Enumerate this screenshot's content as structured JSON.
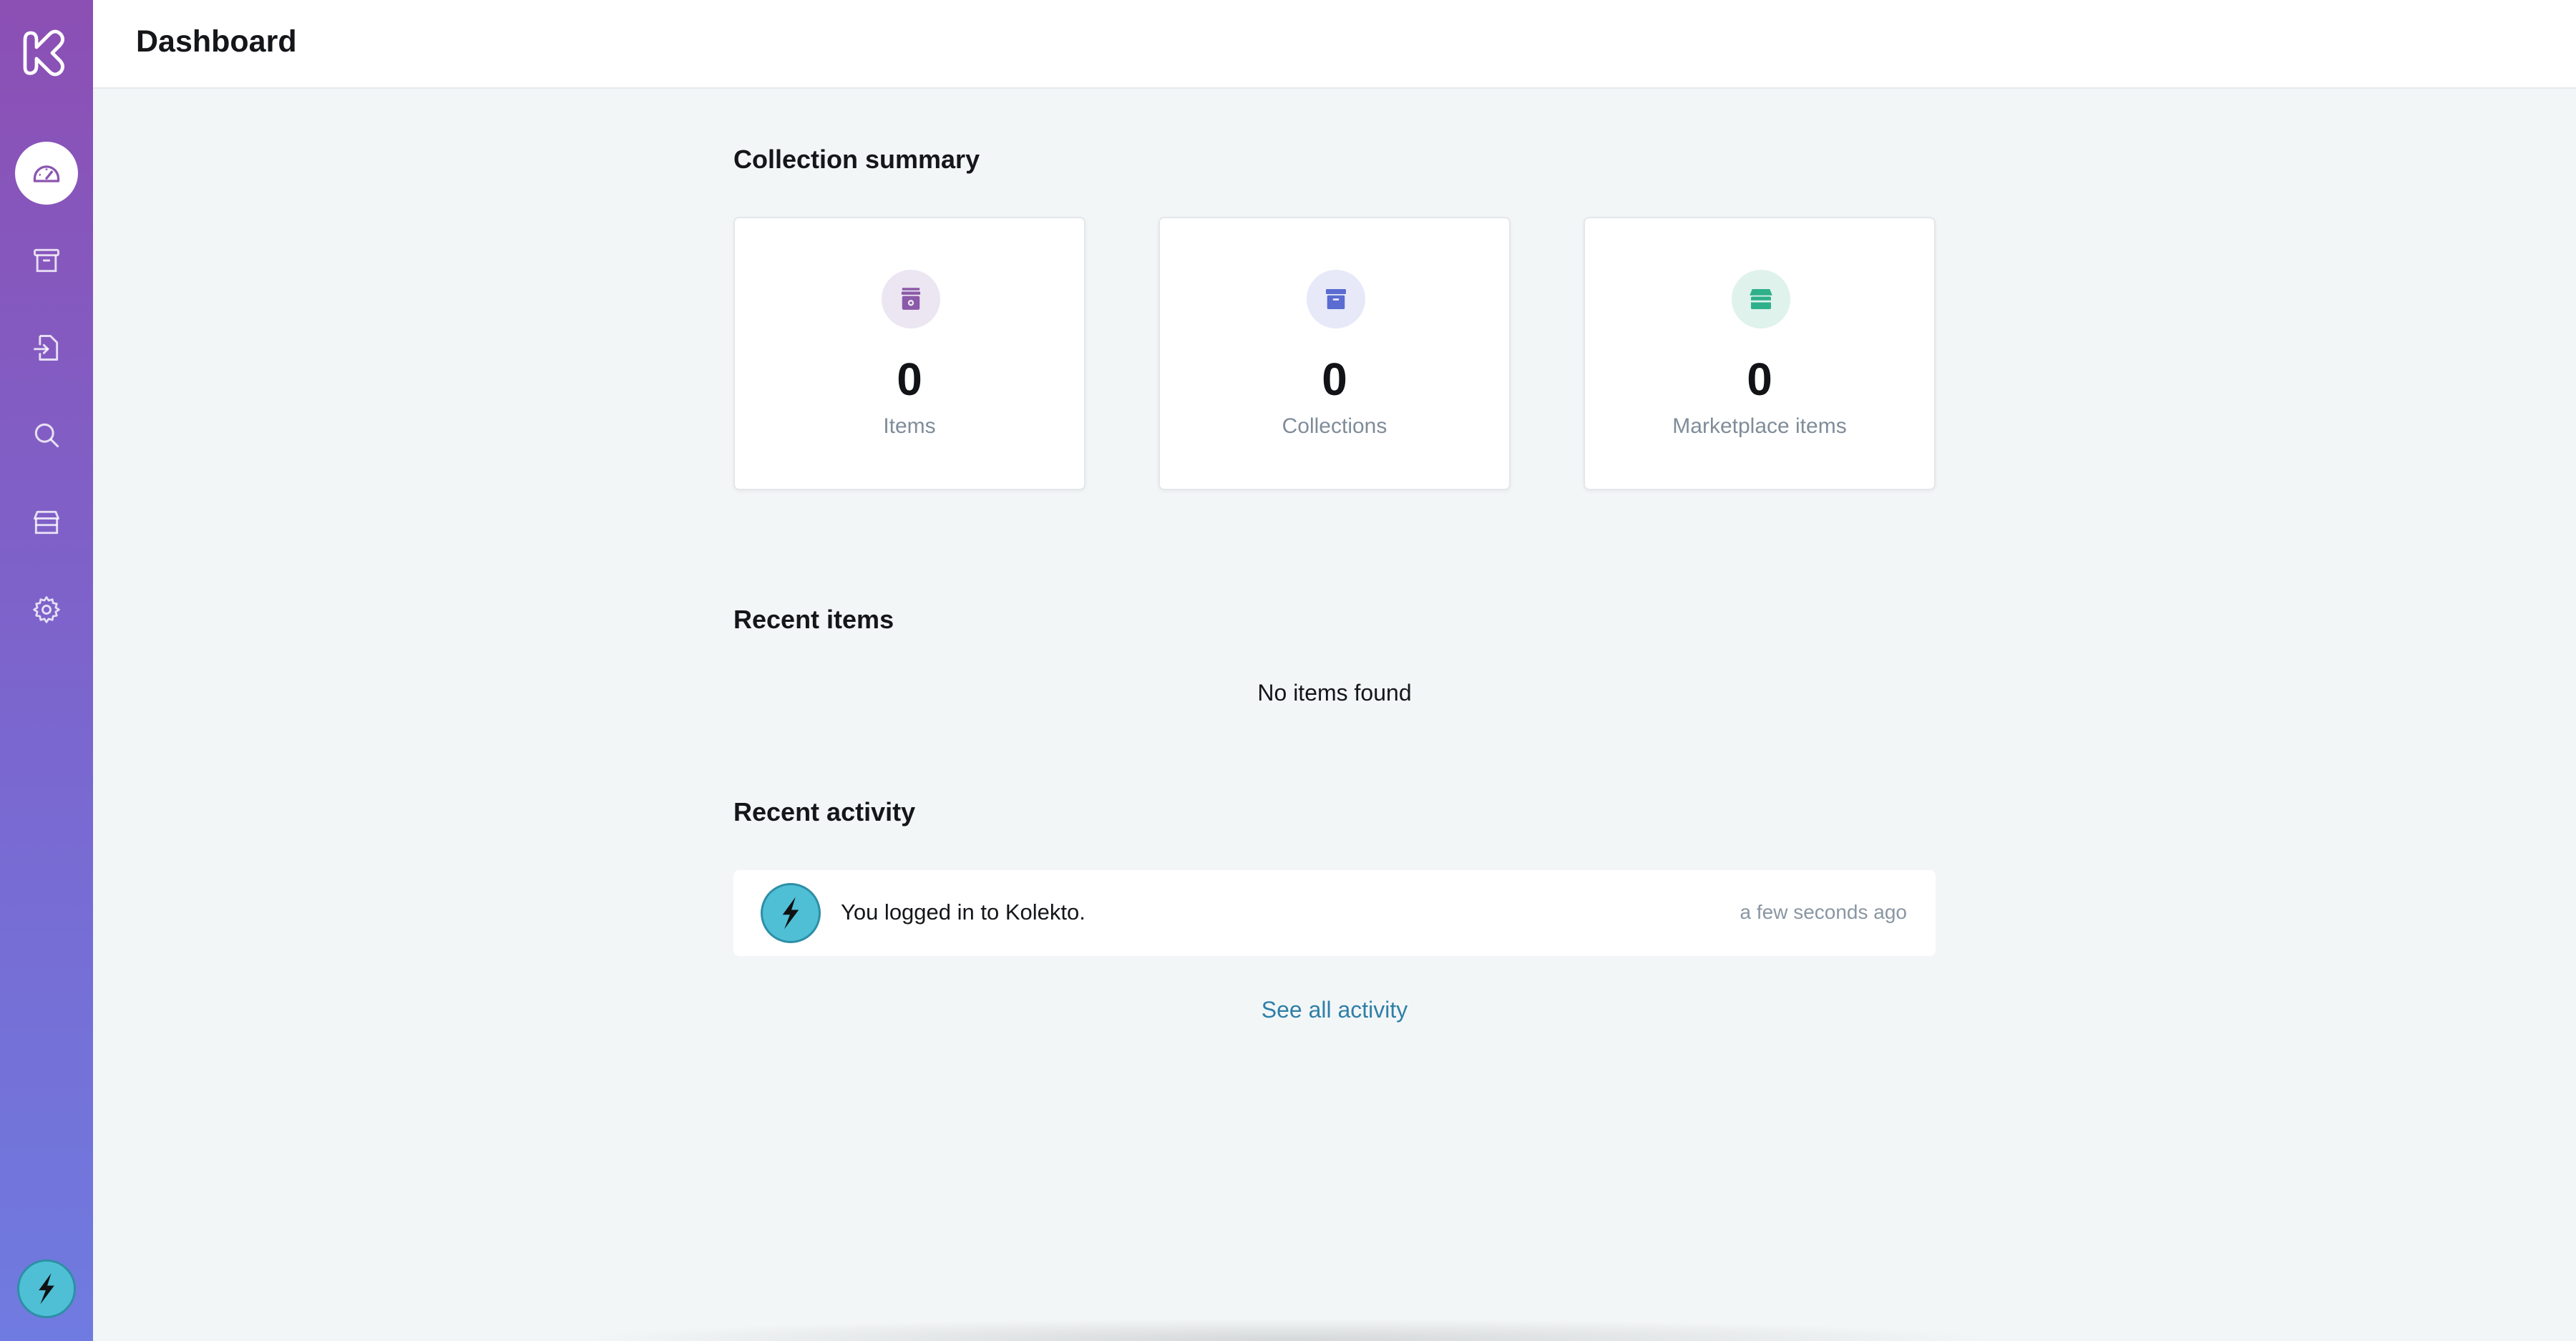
{
  "header": {
    "title": "Dashboard"
  },
  "sidebar": {
    "items": [
      {
        "name": "dashboard",
        "icon": "speedometer-icon",
        "active": true
      },
      {
        "name": "collections",
        "icon": "archive-icon",
        "active": false
      },
      {
        "name": "import",
        "icon": "file-import-icon",
        "active": false
      },
      {
        "name": "search",
        "icon": "search-icon",
        "active": false
      },
      {
        "name": "marketplace",
        "icon": "storefront-icon",
        "active": false
      },
      {
        "name": "settings",
        "icon": "gear-icon",
        "active": false
      }
    ],
    "gradient": [
      "#8c4fb4",
      "#6f7be0"
    ]
  },
  "summary": {
    "title": "Collection summary",
    "cards": [
      {
        "value": "0",
        "label": "Items",
        "icon": "item-box-icon",
        "icon_bg": "#ece6f2",
        "icon_color": "#8b5aa8"
      },
      {
        "value": "0",
        "label": "Collections",
        "icon": "archive-icon",
        "icon_bg": "#e7e9f8",
        "icon_color": "#5a6bd1"
      },
      {
        "value": "0",
        "label": "Marketplace items",
        "icon": "storefront-icon",
        "icon_bg": "#dff2ec",
        "icon_color": "#2eb08a"
      }
    ]
  },
  "recent_items": {
    "title": "Recent items",
    "empty_text": "No items found"
  },
  "recent_activity": {
    "title": "Recent activity",
    "entries": [
      {
        "text": "You logged in to Kolekto.",
        "time": "a few seconds ago"
      }
    ],
    "see_all": "See all activity"
  },
  "colors": {
    "accent_link": "#2f7fa8",
    "muted_text": "#7f8c99"
  }
}
